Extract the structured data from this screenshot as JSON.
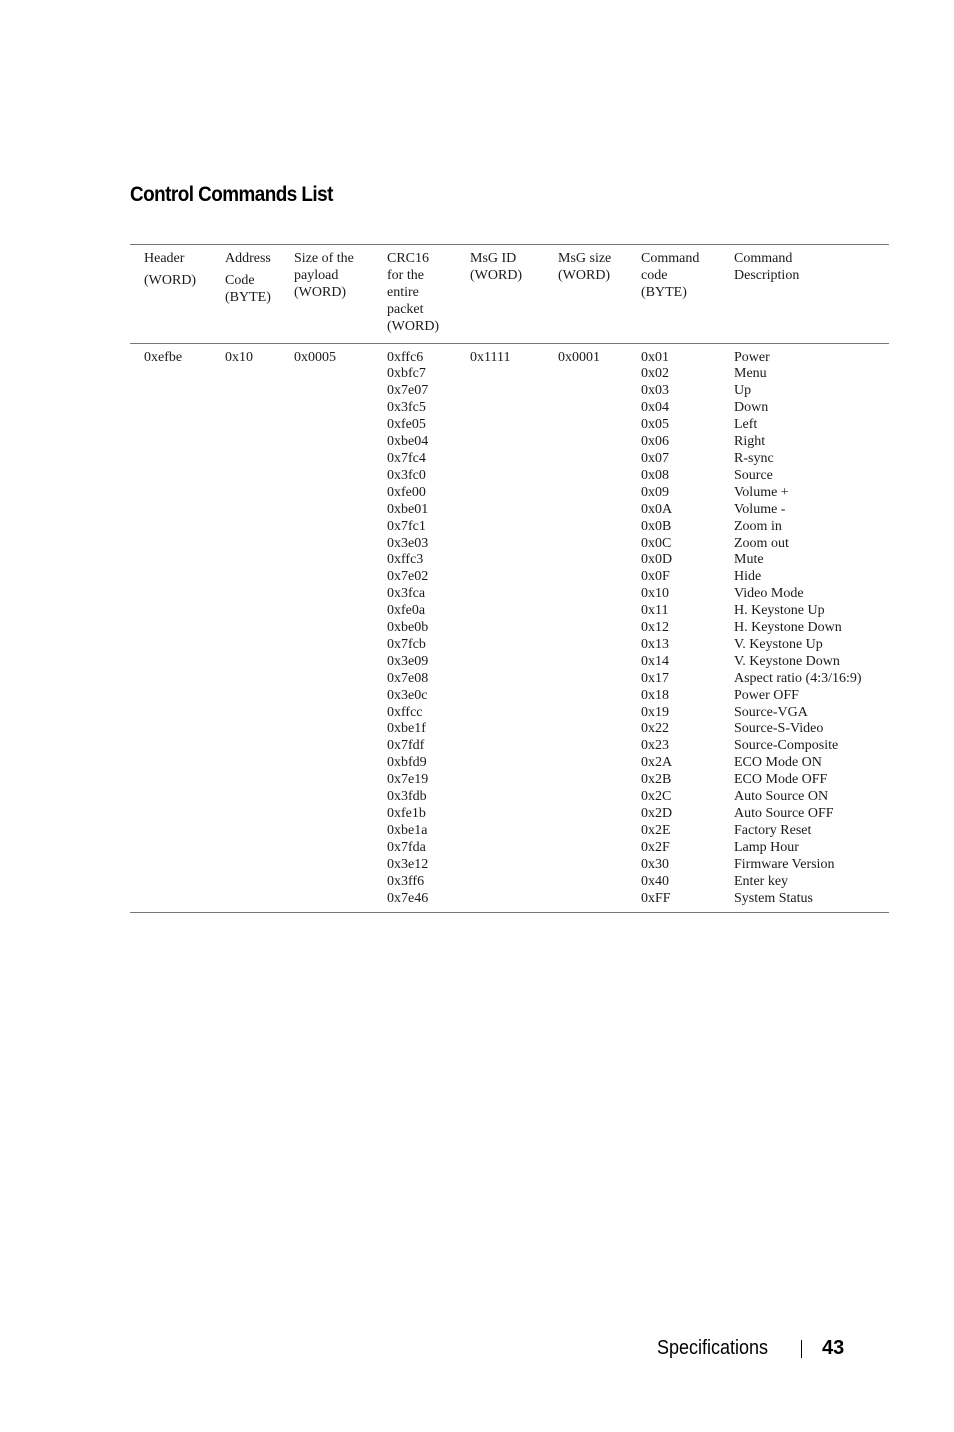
{
  "page": {
    "title": "Control Commands List",
    "footer": {
      "section": "Specifications",
      "page_number": "43"
    }
  },
  "table": {
    "headers": [
      [
        "Header",
        "(WORD)"
      ],
      [
        "Address",
        "Code",
        "(BYTE)"
      ],
      [
        "Size of the",
        "payload",
        "(WORD)"
      ],
      [
        "CRC16",
        "for the",
        "entire",
        "packet",
        "(WORD)"
      ],
      [
        "MsG ID",
        "(WORD)"
      ],
      [
        "MsG size",
        "(WORD)"
      ],
      [
        "Command",
        "code",
        "(BYTE)"
      ],
      [
        "Command",
        "Description"
      ]
    ],
    "header_value": "0xefbe",
    "address_code": "0x10",
    "payload_size": "0x0005",
    "msg_id": "0x1111",
    "msg_size": "0x0001",
    "crc16": [
      "0xffc6",
      "0xbfc7",
      "0x7e07",
      "0x3fc5",
      "0xfe05",
      "0xbe04",
      "0x7fc4",
      "0x3fc0",
      "0xfe00",
      "0xbe01",
      "0x7fc1",
      "0x3e03",
      "0xffc3",
      "0x7e02",
      "0x3fca",
      "0xfe0a",
      "0xbe0b",
      "0x7fcb",
      "0x3e09",
      "0x7e08",
      "0x3e0c",
      "0xffcc",
      "0xbe1f",
      "0x7fdf",
      "0xbfd9",
      "0x7e19",
      "0x3fdb",
      "0xfe1b",
      "0xbe1a",
      "0x7fda",
      "0x3e12",
      "0x3ff6",
      "0x7e46"
    ],
    "command_codes": [
      "0x01",
      "0x02",
      "0x03",
      "0x04",
      "0x05",
      "0x06",
      "0x07",
      "0x08",
      "0x09",
      "0x0A",
      "0x0B",
      "0x0C",
      "0x0D",
      "0x0F",
      "0x10",
      "0x11",
      "0x12",
      "0x13",
      "0x14",
      "0x17",
      "0x18",
      "0x19",
      "0x22",
      "0x23",
      "0x2A",
      "0x2B",
      "0x2C",
      "0x2D",
      "0x2E",
      "0x2F",
      "0x30",
      "0x40",
      "0xFF"
    ],
    "command_descriptions": [
      "Power",
      "Menu",
      "Up",
      "Down",
      "Left",
      "Right",
      "R-sync",
      "Source",
      "Volume +",
      "Volume -",
      "Zoom in",
      "Zoom out",
      "Mute",
      "Hide",
      "Video Mode",
      "H. Keystone Up",
      "H. Keystone Down",
      "V. Keystone Up",
      "V. Keystone Down",
      "Aspect ratio (4:3/16:9)",
      "Power OFF",
      "Source-VGA",
      "Source-S-Video",
      "Source-Composite",
      "ECO Mode ON",
      "ECO Mode OFF",
      "Auto Source ON",
      "Auto Source OFF",
      "Factory Reset",
      "Lamp Hour",
      "Firmware Version",
      "Enter key",
      "System Status"
    ]
  }
}
